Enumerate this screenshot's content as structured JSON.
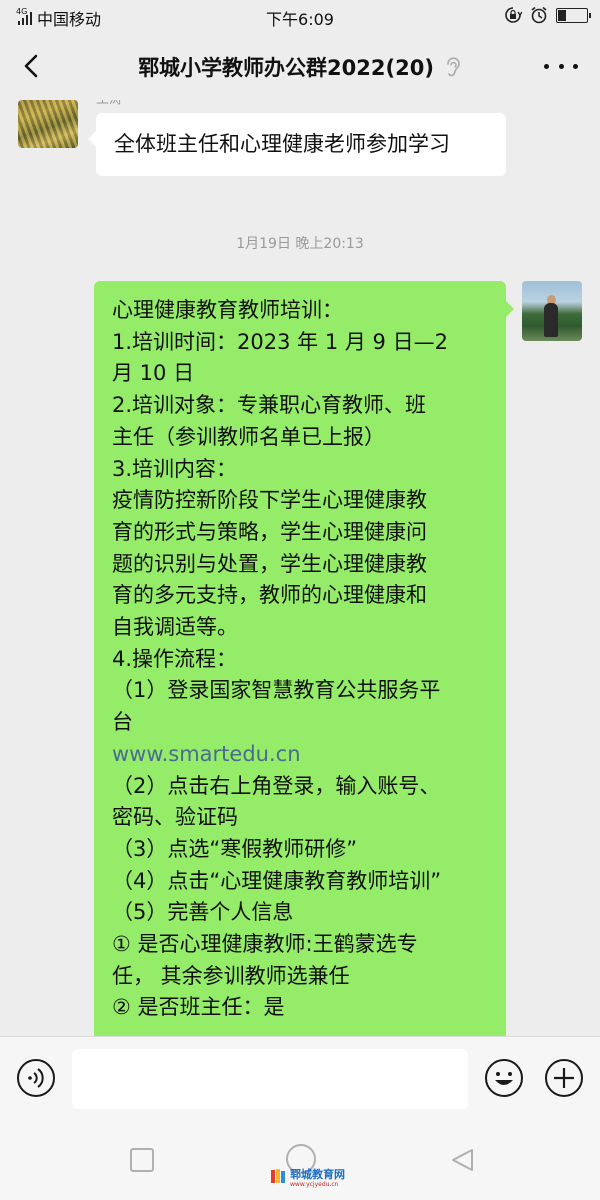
{
  "status_bar": {
    "network_type": "4G",
    "carrier": "中国移动",
    "time": "下午6:09",
    "battery_level": 0.3,
    "icons": [
      "signal-icon",
      "lock-rotation-icon",
      "alarm-icon",
      "battery-icon"
    ]
  },
  "header": {
    "title": "郓城小学教师办公群2022(20)",
    "back_icon": "chevron-left-icon",
    "earpiece_icon": "ear-icon",
    "more_icon": "more-dots-icon"
  },
  "messages": {
    "first": {
      "sender_name": "王涛",
      "text": "全体班主任和心理健康老师参加学习"
    },
    "timestamp": "1月19日 晚上20:13",
    "second": {
      "lines": [
        "心理健康教育教师培训：",
        "1.培训时间：2023 年 1 月 9 日—2",
        "月 10 日",
        "2.培训对象：专兼职心育教师、班",
        "主任（参训教师名单已上报）",
        "3.培训内容：",
        "疫情防控新阶段下学生心理健康教",
        "育的形式与策略，学生心理健康问",
        "题的识别与处置，学生心理健康教",
        "育的多元支持，教师的心理健康和",
        "自我调适等。",
        "4.操作流程：",
        "（1）登录国家智慧教育公共服务平",
        "台",
        "www.smartedu.cn",
        "（2）点击右上角登录，输入账号、",
        "密码、验证码",
        "（3）点选“寒假教师研修”",
        "（4）点击“心理健康教育教师培训”",
        "（5）完善个人信息",
        "① 是否心理健康教师:王鹤蒙选专",
        "任， 其余参训教师选兼任",
        "② 是否班主任：是"
      ],
      "link_line_index": 14
    }
  },
  "input_bar": {
    "placeholder": "",
    "voice_icon": "voice-icon",
    "emoji_icon": "emoji-icon",
    "plus_icon": "plus-icon"
  },
  "nav_bar": {
    "watermark_title": "郓城教育网",
    "watermark_url": "www.ycjyedu.cn"
  },
  "colors": {
    "background": "#ededed",
    "bubble_self": "#95ec69",
    "bubble_other": "#ffffff",
    "link": "#4a6c8f"
  }
}
